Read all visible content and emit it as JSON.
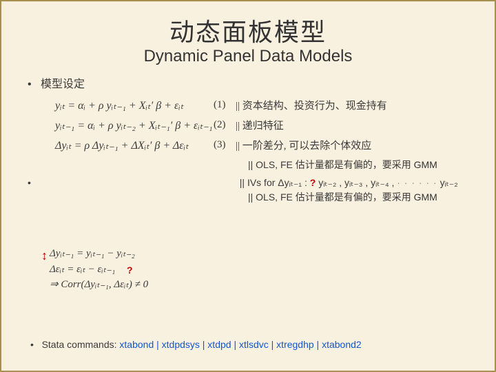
{
  "title": {
    "cn": "动态面板模型",
    "en": "Dynamic Panel Data Models"
  },
  "bullet_model_spec": "模型设定",
  "eq": {
    "f1": "yᵢₜ = αᵢ + ρ yᵢₜ₋₁ + Xᵢₜ′ β + εᵢₜ",
    "n1": "(1)",
    "d1": "||  资本结构、投资行为、现金持有",
    "f2": "yᵢₜ₋₁ = αᵢ + ρ yᵢₜ₋₂ + Xᵢₜ₋₁′ β + εᵢₜ₋₁",
    "n2": "(2)",
    "d2": "||  递归特征",
    "f3": "Δyᵢₜ = ρ Δyᵢₜ₋₁ + ΔXᵢₜ′ β + Δεᵢₜ",
    "n3": "(3)",
    "d3": "||  一阶差分, 可以去除个体效应"
  },
  "diag": {
    "r1": "Δyᵢₜ₋₁ =     yᵢₜ₋₁ − yᵢₜ₋₂",
    "r2": "Δεᵢₜ = εᵢₜ − εᵢₜ₋₁",
    "r3": "⇒ Corr(Δyᵢₜ₋₁, Δεᵢₜ) ≠ 0"
  },
  "notes": {
    "l1_a": "|| OLS, FE 估计量都是有偏的，要采用  ",
    "l1_b": "GMM",
    "l2_a": "|| IVs for Δyᵢₜ₋₁ : ",
    "l2_q": "?",
    "l2_b": "  yᵢₜ₋₂ , yᵢₜ₋₃ , yᵢₜ₋₄ , ",
    "l2_dots": "· · · · · ·",
    "l2_c": " yᵢₜ₋₂",
    "l3_a": "  || OLS, FE 估计量都是有偏的，要采用  ",
    "l3_b": "GMM"
  },
  "stata": {
    "label": "Stata commands:  ",
    "cmds": "xtabond | xtdpdsys | xtdpd | xtlsdvc | xtregdhp | xtabond2"
  },
  "bullets": {
    "dot": "•"
  }
}
